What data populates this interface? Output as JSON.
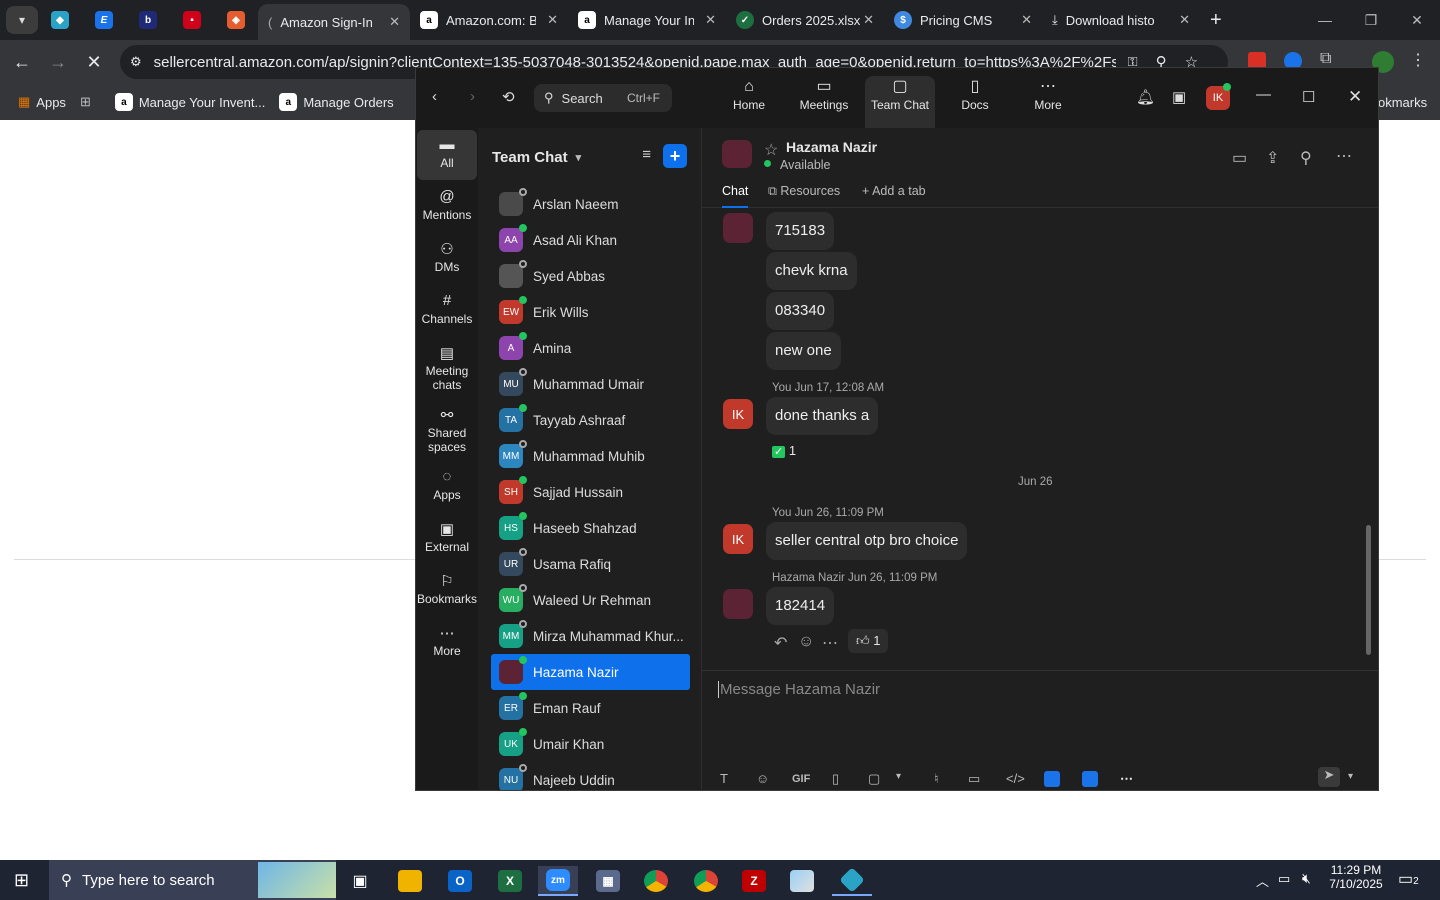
{
  "browser": {
    "tabs": [
      {
        "title": "Amazon Sign-In",
        "active": true
      },
      {
        "title": "Amazon.com: Br"
      },
      {
        "title": "Manage Your In"
      },
      {
        "title": "Orders 2025.xlsx"
      },
      {
        "title": "Pricing CMS"
      },
      {
        "title": "Download histo"
      }
    ],
    "url": "sellercentral.amazon.com/ap/signin?clientContext=135-5037048-3013524&openid.pape.max_auth_age=0&openid.return_to=https%3A%2F%2Fsellercentr...",
    "bookmarks": [
      "Apps",
      "Manage Your Invent...",
      "Manage Orders"
    ],
    "bookmarks_right": "okmarks"
  },
  "zoom": {
    "search_label": "Search",
    "search_shortcut": "Ctrl+F",
    "nav": [
      "Home",
      "Meetings",
      "Team Chat",
      "Docs",
      "More"
    ],
    "avatar_initials": "IK",
    "rail": [
      {
        "label": "All",
        "icon": "chat-icon"
      },
      {
        "label": "Mentions",
        "icon": "at-icon"
      },
      {
        "label": "DMs",
        "icon": "people-icon"
      },
      {
        "label": "Channels",
        "icon": "hash-icon"
      },
      {
        "label": "Meeting chats",
        "icon": "calendar-icon"
      },
      {
        "label": "Shared spaces",
        "icon": "share-icon"
      },
      {
        "label": "Apps",
        "icon": "apps-icon"
      },
      {
        "label": "External",
        "icon": "external-icon"
      },
      {
        "label": "Bookmarks",
        "icon": "bookmark-icon"
      },
      {
        "label": "More",
        "icon": "more-icon"
      }
    ],
    "list_title": "Team Chat",
    "contacts": [
      {
        "name": "Arslan Naeem",
        "initials": "",
        "color": "#4a4a4a",
        "online": false
      },
      {
        "name": "Asad Ali Khan",
        "initials": "AA",
        "color": "#8e44ad",
        "online": true
      },
      {
        "name": "Syed Abbas",
        "initials": "",
        "color": "#555555",
        "online": false
      },
      {
        "name": "Erik Wills",
        "initials": "EW",
        "color": "#c0392b",
        "online": true
      },
      {
        "name": "Amina",
        "initials": "A",
        "color": "#8e44ad",
        "online": true
      },
      {
        "name": "Muhammad Umair",
        "initials": "MU",
        "color": "#34495e",
        "online": false
      },
      {
        "name": "Tayyab Ashraaf",
        "initials": "TA",
        "color": "#2471a3",
        "online": true
      },
      {
        "name": "Muhammad Muhib",
        "initials": "MM",
        "color": "#2e86c1",
        "online": false
      },
      {
        "name": "Sajjad Hussain",
        "initials": "SH",
        "color": "#c0392b",
        "online": true
      },
      {
        "name": "Haseeb Shahzad",
        "initials": "HS",
        "color": "#16a085",
        "online": true
      },
      {
        "name": "Usama Rafiq",
        "initials": "UR",
        "color": "#34495e",
        "online": false
      },
      {
        "name": "Waleed Ur Rehman",
        "initials": "WU",
        "color": "#27ae60",
        "online": false
      },
      {
        "name": "Mirza Muhammad Khur...",
        "initials": "MM",
        "color": "#16a085",
        "online": false
      },
      {
        "name": "Hazama Nazir",
        "initials": "",
        "color": "#5b2333",
        "online": true,
        "selected": true
      },
      {
        "name": "Eman Rauf",
        "initials": "ER",
        "color": "#2471a3",
        "online": true
      },
      {
        "name": "Umair Khan",
        "initials": "UK",
        "color": "#16a085",
        "online": true
      },
      {
        "name": "Najeeb Uddin",
        "initials": "NU",
        "color": "#2471a3",
        "online": false
      }
    ],
    "chat": {
      "name": "Hazama Nazir",
      "status": "Available",
      "tabs": [
        "Chat",
        "Resources",
        "Add a tab"
      ],
      "messages": [
        {
          "text": "715183"
        },
        {
          "text": "chevk krna"
        },
        {
          "text": "083340"
        },
        {
          "text": "new one"
        },
        {
          "meta": "You Jun 17, 12:08 AM",
          "text": "done thanks a",
          "reaction": "1"
        },
        {
          "date": "Jun 26"
        },
        {
          "meta": "You Jun 26, 11:09 PM",
          "text": "seller central otp bro choice"
        },
        {
          "meta": "Hazama Nazir Jun 26, 11:09 PM",
          "text": "182414",
          "reaction": "1"
        }
      ],
      "composer_placeholder": "Message Hazama Nazir",
      "gif_label": "GIF"
    }
  },
  "taskbar": {
    "search_placeholder": "Type here to search",
    "time": "11:29 PM",
    "date": "7/10/2025",
    "notif_count": "2"
  }
}
